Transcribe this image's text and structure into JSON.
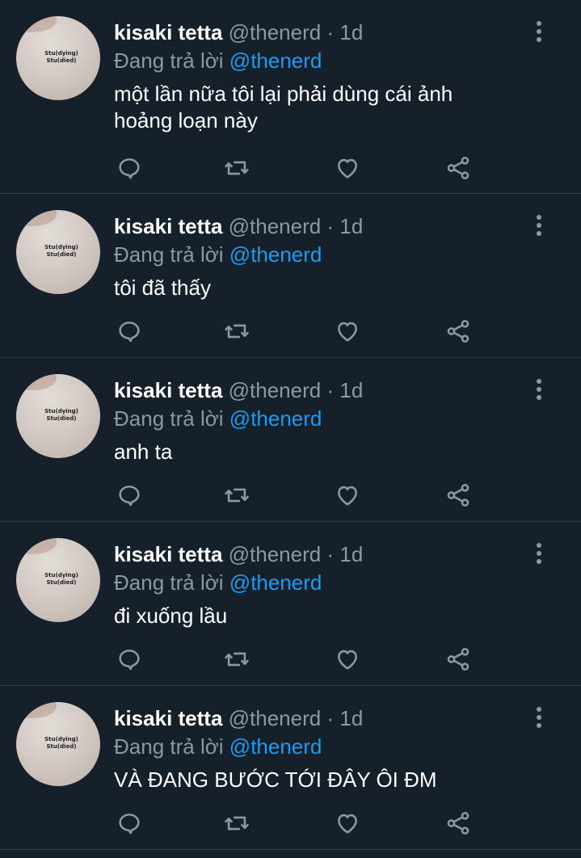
{
  "tweets": [
    {
      "name": "kisaki tetta",
      "handle": "@thenerd",
      "separator": "·",
      "time": "1d",
      "reply_prefix": "Đang trả lời",
      "reply_to": "@thenerd",
      "text": "một lần nữa tôi lại phải dùng cái ảnh hoảng loạn này"
    },
    {
      "name": "kisaki tetta",
      "handle": "@thenerd",
      "separator": "·",
      "time": "1d",
      "reply_prefix": "Đang trả lời",
      "reply_to": "@thenerd",
      "text": "tôi đã thấy"
    },
    {
      "name": "kisaki tetta",
      "handle": "@thenerd",
      "separator": "·",
      "time": "1d",
      "reply_prefix": "Đang trả lời",
      "reply_to": "@thenerd",
      "text": "anh ta"
    },
    {
      "name": "kisaki tetta",
      "handle": "@thenerd",
      "separator": "·",
      "time": "1d",
      "reply_prefix": "Đang trả lời",
      "reply_to": "@thenerd",
      "text": "đi xuống lầu"
    },
    {
      "name": "kisaki tetta",
      "handle": "@thenerd",
      "separator": "·",
      "time": "1d",
      "reply_prefix": "Đang trả lời",
      "reply_to": "@thenerd",
      "text": "VÀ ĐANG BƯỚC TỚI ĐÂY ÔI ĐM"
    }
  ],
  "avatar_shirt_text": [
    "Stu(dying)",
    "Stu(died)"
  ],
  "icons": {
    "reply": "reply-icon",
    "retweet": "retweet-icon",
    "like": "heart-icon",
    "share": "share-icon",
    "more": "more-vertical-icon"
  },
  "colors": {
    "background": "#15202b",
    "secondary_text": "#8b98a5",
    "accent": "#1d9bf0"
  }
}
